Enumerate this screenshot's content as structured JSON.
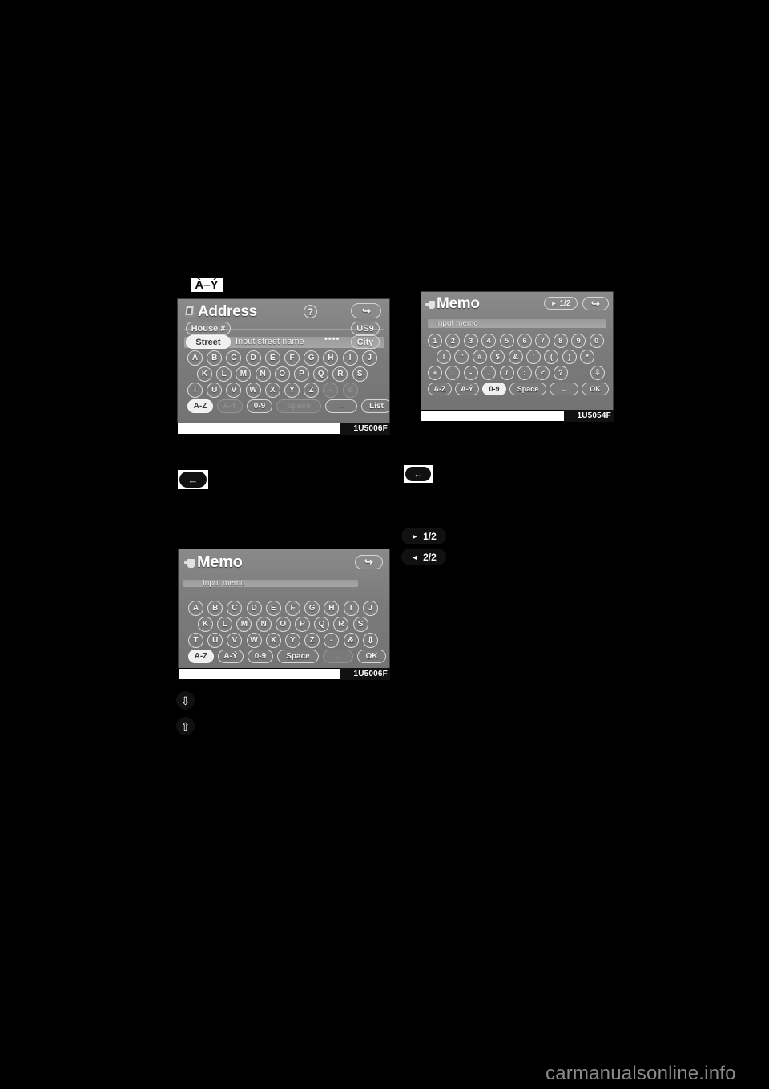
{
  "page": {
    "background": "#000000",
    "site_url": "carmanualsonline.info"
  },
  "callouts": {
    "accent_chip": "À–Ý",
    "back_arrow": "←",
    "page_next": "1/2",
    "page_prev": "2/2",
    "arrow_right_glyph": "►",
    "arrow_left_glyph": "◄",
    "down_arrow": "⇩",
    "up_arrow": "⇧"
  },
  "figures": {
    "address": {
      "code": "1U5006F",
      "title": "Address",
      "title_icon": "address-book-icon",
      "help_label": "?",
      "back_label": "↩",
      "fields": {
        "house_number_label": "House #",
        "street_label": "Street",
        "input_placeholder": "Input street name",
        "input_dots": "••••",
        "region_label": "US9",
        "city_label": "City"
      },
      "keyboard": {
        "row1": [
          "A",
          "B",
          "C",
          "D",
          "E",
          "F",
          "G",
          "H",
          "I",
          "J"
        ],
        "row2": [
          "K",
          "L",
          "M",
          "N",
          "O",
          "P",
          "Q",
          "R",
          "S"
        ],
        "row3": [
          "T",
          "U",
          "V",
          "W",
          "X",
          "Y",
          "Z"
        ],
        "row3_extra": [
          "-",
          "&"
        ],
        "row3_extra_disabled": true,
        "bottom": [
          {
            "label": "A-Z",
            "state": "selected"
          },
          {
            "label": "A-Ý",
            "state": "disabled"
          },
          {
            "label": "0-9",
            "state": "normal"
          },
          {
            "label": "Space",
            "state": "disabled"
          },
          {
            "label": "←",
            "state": "normal"
          },
          {
            "label": "List",
            "state": "normal"
          }
        ]
      }
    },
    "memo_numeric": {
      "code": "1U5054F",
      "title": "Memo",
      "title_icon": "memo-pen-icon",
      "page_label": "1/2",
      "page_arrow": "►",
      "back_label": "↩",
      "input_placeholder": "Input memo",
      "keyboard": {
        "row1": [
          "1",
          "2",
          "3",
          "4",
          "5",
          "6",
          "7",
          "8",
          "9",
          "0"
        ],
        "row2": [
          "!",
          "\"",
          "#",
          "$",
          "&",
          "'",
          "(",
          ")",
          "*"
        ],
        "row3": [
          "+",
          ",",
          "-",
          ".",
          "/",
          ":",
          "<",
          "?"
        ],
        "row3_tail": "⇩",
        "bottom": [
          {
            "label": "A-Z",
            "state": "normal"
          },
          {
            "label": "A-Ý",
            "state": "normal"
          },
          {
            "label": "0-9",
            "state": "selected"
          },
          {
            "label": "Space",
            "state": "normal"
          },
          {
            "label": "←",
            "state": "normal"
          },
          {
            "label": "OK",
            "state": "normal"
          }
        ]
      }
    },
    "memo_alpha": {
      "code": "1U5006F",
      "title": "Memo",
      "title_icon": "memo-pen-icon",
      "back_label": "↩",
      "input_placeholder": "Input memo",
      "keyboard": {
        "row1": [
          "A",
          "B",
          "C",
          "D",
          "E",
          "F",
          "G",
          "H",
          "I",
          "J"
        ],
        "row2": [
          "K",
          "L",
          "M",
          "N",
          "O",
          "P",
          "Q",
          "R",
          "S"
        ],
        "row3": [
          "T",
          "U",
          "V",
          "W",
          "X",
          "Y",
          "Z",
          "-",
          "&"
        ],
        "row3_tail": "⇩",
        "bottom": [
          {
            "label": "A-Z",
            "state": "selected"
          },
          {
            "label": "A-Ý",
            "state": "normal"
          },
          {
            "label": "0-9",
            "state": "normal"
          },
          {
            "label": "Space",
            "state": "normal"
          },
          {
            "label": "←",
            "state": "disabled"
          },
          {
            "label": "OK",
            "state": "normal"
          }
        ]
      }
    }
  }
}
